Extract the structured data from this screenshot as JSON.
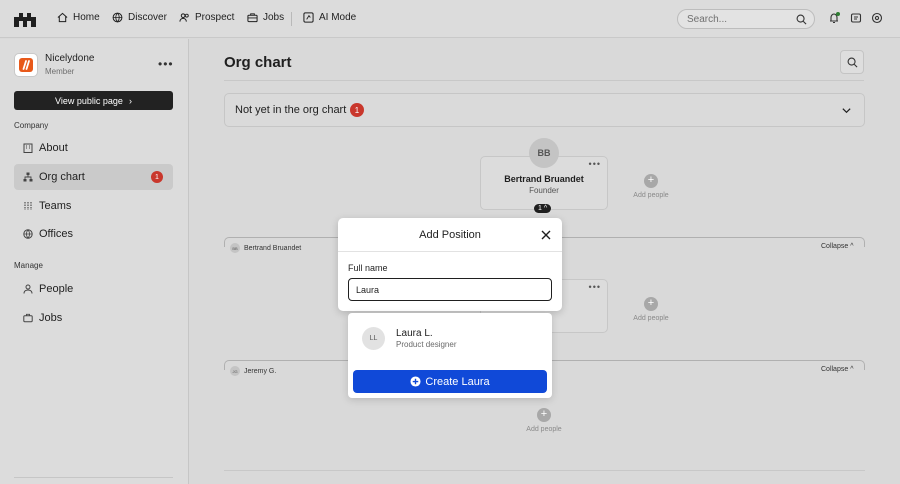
{
  "nav": {
    "items": [
      {
        "label": "Home",
        "icon": "home-icon"
      },
      {
        "label": "Discover",
        "icon": "globe-icon"
      },
      {
        "label": "Prospect",
        "icon": "people-icon"
      },
      {
        "label": "Jobs",
        "icon": "briefcase-icon"
      },
      {
        "label": "AI Mode",
        "icon": "ai-icon"
      }
    ],
    "search_placeholder": "Search..."
  },
  "sidebar": {
    "brand_name": "Nicelydone",
    "brand_role": "Member",
    "public_button": "View public page",
    "company_label": "Company",
    "company_items": [
      {
        "label": "About",
        "icon": "building-icon"
      },
      {
        "label": "Org chart",
        "icon": "org-chart-icon",
        "badge": "1"
      },
      {
        "label": "Teams",
        "icon": "teams-icon"
      },
      {
        "label": "Offices",
        "icon": "globe-icon"
      }
    ],
    "manage_label": "Manage",
    "manage_items": [
      {
        "label": "People",
        "icon": "people-icon"
      },
      {
        "label": "Jobs",
        "icon": "briefcase-icon"
      }
    ]
  },
  "main": {
    "title": "Org chart",
    "not_yet_label": "Not yet in the org chart",
    "not_yet_badge": "1",
    "root_card": {
      "initials": "BB",
      "name": "Bertrand Bruandet",
      "role": "Founder",
      "count": "1"
    },
    "add_people": "Add people",
    "group1": {
      "initials": "BB",
      "name": "Bertrand Bruandet",
      "collapse": "Collapse"
    },
    "group2": {
      "initials": "JG",
      "name": "Jeremy G.",
      "collapse": "Collapse"
    }
  },
  "modal": {
    "title": "Add Position",
    "field_label": "Full name",
    "field_value": "Laura"
  },
  "dropdown": {
    "suggestion": {
      "initials": "LL",
      "name": "Laura L.",
      "role": "Product designer"
    },
    "create_label": "Create Laura"
  },
  "colors": {
    "accent": "#1049d8",
    "badge": "#c9372c",
    "brand": "#e8591a"
  }
}
